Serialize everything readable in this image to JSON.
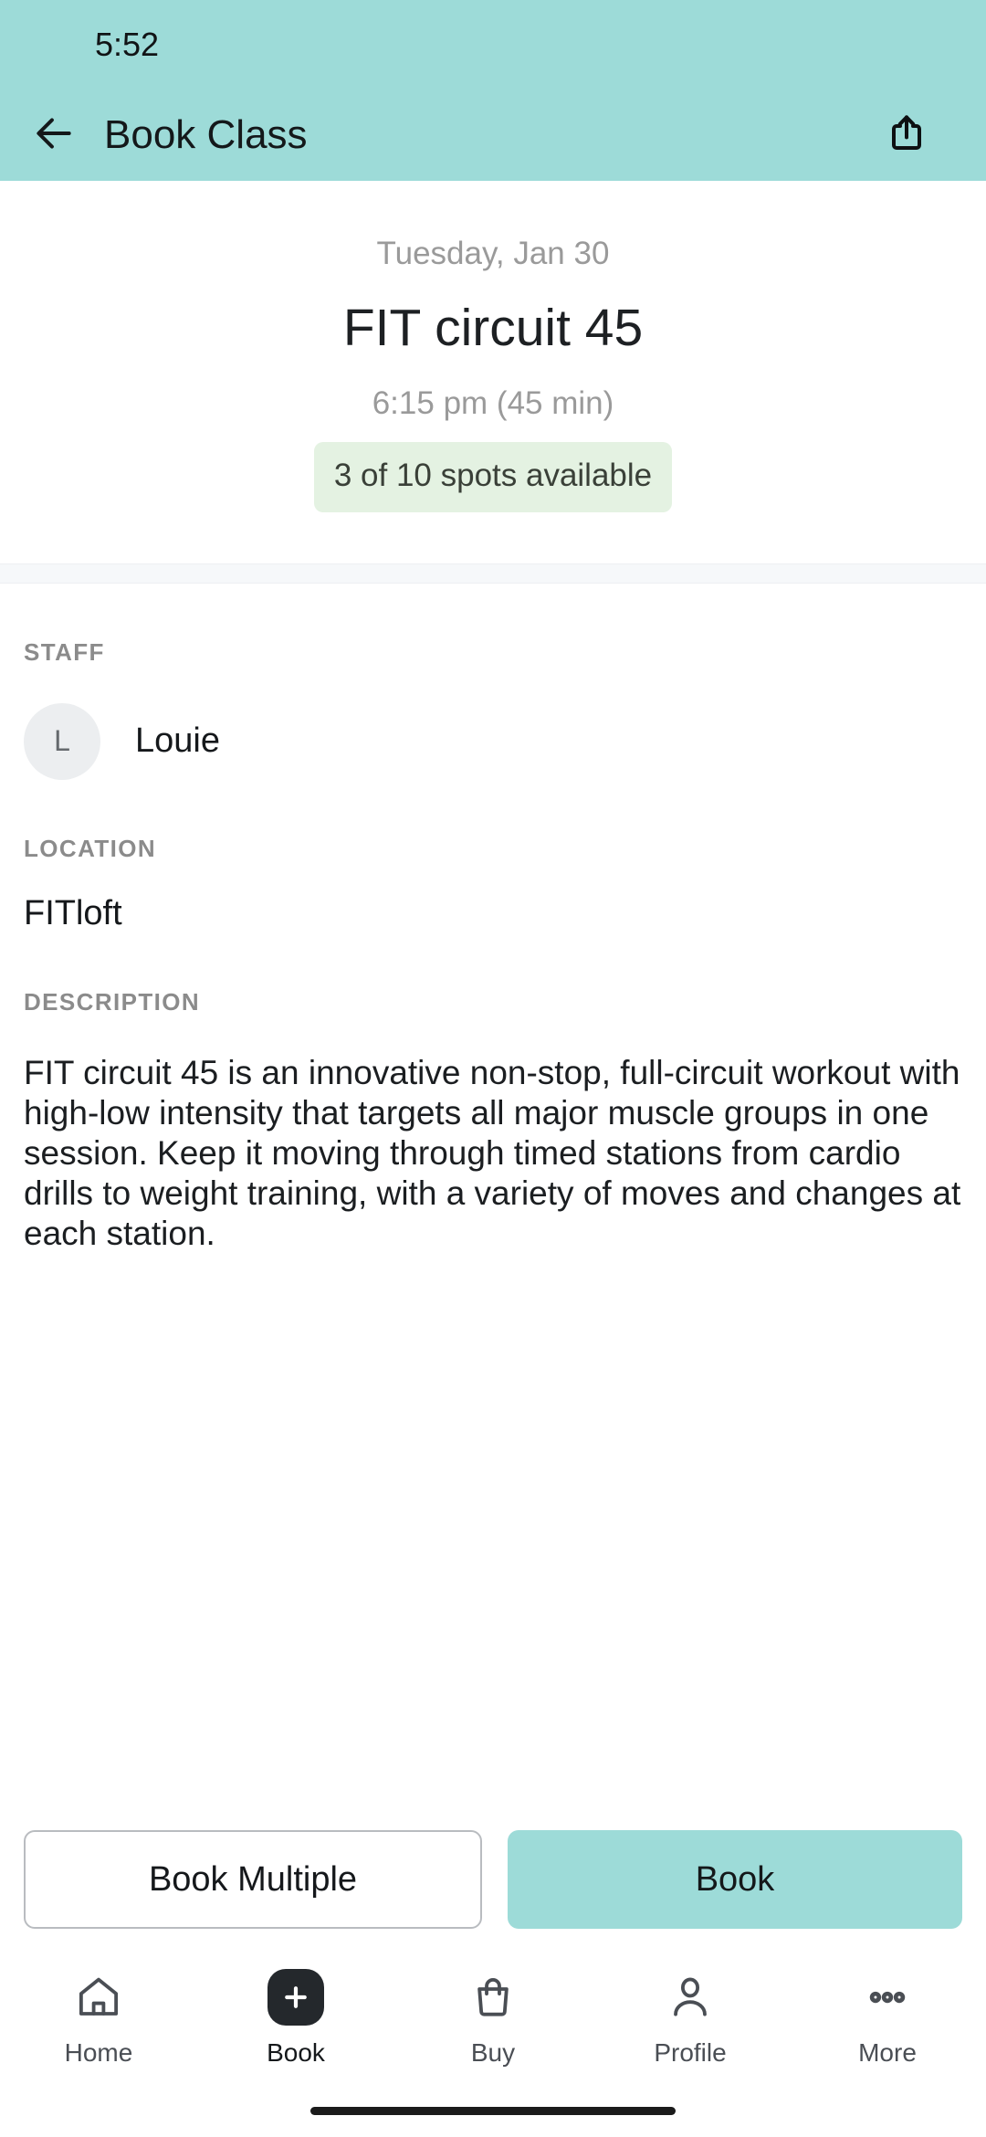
{
  "status_bar": {
    "clock": "5:52"
  },
  "app_bar": {
    "title": "Book Class",
    "back_icon": "arrow-left-icon",
    "share_icon": "share-icon"
  },
  "hero": {
    "date": "Tuesday, Jan 30",
    "class_name": "FIT circuit 45",
    "time": "6:15 pm (45 min)",
    "spots": "3 of 10 spots available"
  },
  "details": {
    "staff_label": "STAFF",
    "staff_initial": "L",
    "staff_name": "Louie",
    "location_label": "LOCATION",
    "location_name": "FITloft",
    "description_label": "DESCRIPTION",
    "description": "FIT circuit 45 is an innovative non-stop, full-circuit workout with high-low intensity that targets all major muscle groups in one session. Keep it moving through timed stations from cardio drills to weight training, with a variety of moves and changes at each station."
  },
  "actions": {
    "secondary_label": "Book Multiple",
    "primary_label": "Book"
  },
  "tabbar": {
    "items": [
      {
        "label": "Home",
        "icon": "home-icon",
        "active": false
      },
      {
        "label": "Book",
        "icon": "plus-icon",
        "active": true
      },
      {
        "label": "Buy",
        "icon": "bag-icon",
        "active": false
      },
      {
        "label": "Profile",
        "icon": "person-icon",
        "active": false
      },
      {
        "label": "More",
        "icon": "ellipsis-icon",
        "active": false
      }
    ]
  },
  "colors": {
    "brand_teal": "#9ddbd8",
    "spots_badge_bg": "#e4f2e2",
    "avatar_bg": "#eceef0",
    "band_bg": "#f6f8fa",
    "active_tab_bg": "#24282c"
  }
}
